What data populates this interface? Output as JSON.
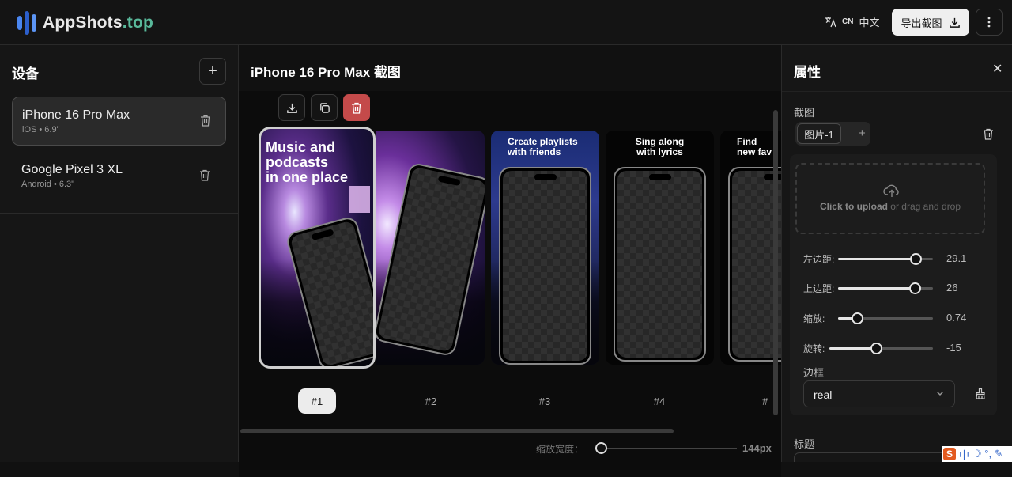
{
  "app": {
    "brand": "AppShots",
    "brand_tld": ".top"
  },
  "header": {
    "lang_code": "CN",
    "lang_label": "中文",
    "export_label": "导出截图"
  },
  "devices": {
    "title": "设备",
    "items": [
      {
        "name": "iPhone 16 Pro Max",
        "meta": "iOS • 6.9\"",
        "active": true
      },
      {
        "name": "Google Pixel 3 XL",
        "meta": "Android • 6.3\"",
        "active": false
      }
    ]
  },
  "editor": {
    "title": "iPhone 16 Pro Max 截图",
    "screenshots": [
      {
        "label": "#1",
        "lines": [
          "Music and",
          "podcasts",
          "in one place"
        ],
        "selected": true
      },
      {
        "label": "#2",
        "lines": [],
        "selected": false
      },
      {
        "label": "#3",
        "lines": [
          "Create playlists",
          "with friends"
        ],
        "selected": false
      },
      {
        "label": "#4",
        "lines": [
          "Sing along",
          "with lyrics"
        ],
        "selected": false
      },
      {
        "label": "#",
        "lines": [
          "Find",
          "new fav"
        ],
        "selected": false
      }
    ],
    "zoom_label": "缩放宽度：",
    "zoom_value": "144px"
  },
  "properties": {
    "title": "属性",
    "screenshot_label": "截图",
    "image_tab": "图片-1",
    "upload_cta": "Click to upload",
    "upload_rest": " or drag and drop",
    "sliders": [
      {
        "label": "左边距:",
        "value": "29.1",
        "fraction": 0.82
      },
      {
        "label": "上边距:",
        "value": "26",
        "fraction": 0.81
      },
      {
        "label": "缩放:",
        "value": "0.74",
        "fraction": 0.2
      },
      {
        "label": "旋转:",
        "value": "-15",
        "fraction": 0.45
      }
    ],
    "frame_label": "边框",
    "frame_value": "real",
    "title_label": "标题"
  },
  "ime": {
    "logo": "S",
    "mode": "中",
    "extras": "☽ °, ✎"
  }
}
